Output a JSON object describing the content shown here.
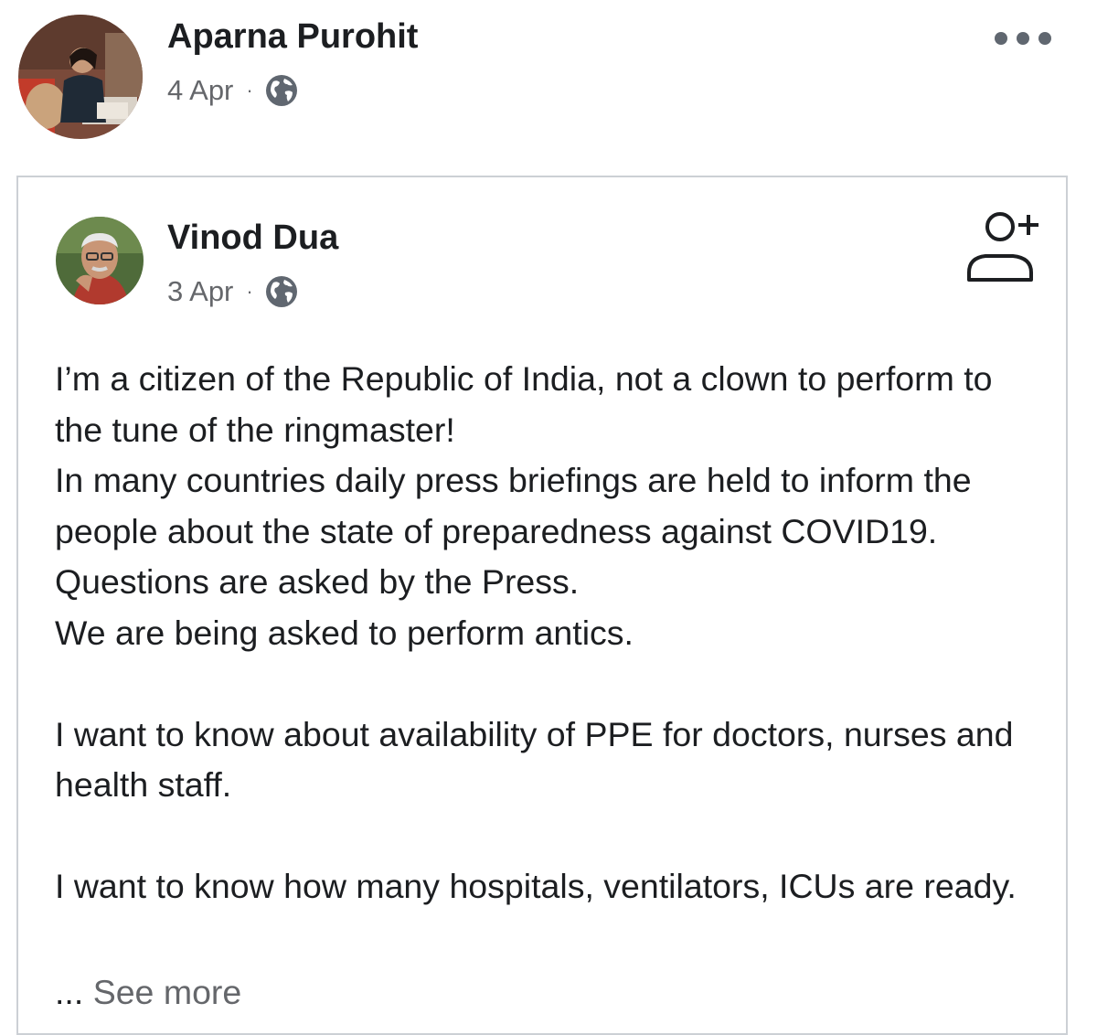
{
  "sharer": {
    "name": "Aparna Purohit",
    "date": "4 Apr",
    "separator": "·",
    "privacy_icon": "globe-icon"
  },
  "more_icon": "more-options-icon",
  "shared_post": {
    "author": {
      "name": "Vinod Dua",
      "date": "3 Apr",
      "separator": "·",
      "privacy_icon": "globe-icon"
    },
    "add_friend_icon": "add-friend-icon",
    "paragraphs": [
      "I’m a citizen of the Republic of India, not a clown to perform to the tune of the ringmaster!",
      "In many countries daily press briefings are held to inform the people about the state of preparedness against COVID19. Questions are asked by the Press.",
      "We are being asked to perform antics.",
      "",
      "I want to know about availability of PPE for doctors, nurses and health staff.",
      "",
      "I want to know how many hospitals, ventilators, ICUs are ready."
    ],
    "ellipsis": "...",
    "see_more": "See more"
  }
}
